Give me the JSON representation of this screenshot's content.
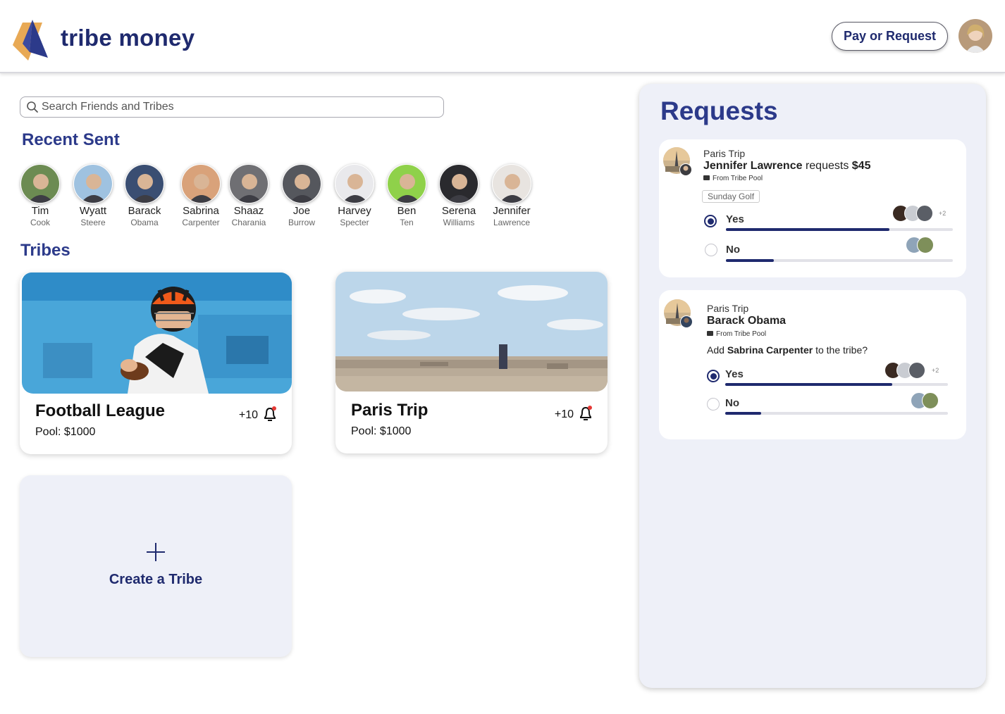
{
  "header": {
    "brand": "tribe money",
    "pay_request_label": "Pay or Request"
  },
  "search": {
    "placeholder": "Search Friends and Tribes",
    "value": ""
  },
  "recent": {
    "title": "Recent Sent",
    "friends": [
      {
        "first": "Tim",
        "last": "Cook",
        "color": "#6c8b52"
      },
      {
        "first": "Wyatt",
        "last": "Steere",
        "color": "#9fc2e0"
      },
      {
        "first": "Barack",
        "last": "Obama",
        "color": "#3a4e72"
      },
      {
        "first": "Sabrina",
        "last": "Carpenter",
        "color": "#d9a27a"
      },
      {
        "first": "Shaaz",
        "last": "Charania",
        "color": "#6f6f73"
      },
      {
        "first": "Joe",
        "last": "Burrow",
        "color": "#55575d"
      },
      {
        "first": "Harvey",
        "last": "Specter",
        "color": "#e9e9ec"
      },
      {
        "first": "Ben",
        "last": "Ten",
        "color": "#8fd14a"
      },
      {
        "first": "Serena",
        "last": "Williams",
        "color": "#2a2a2e"
      },
      {
        "first": "Jennifer",
        "last": "Lawrence",
        "color": "#e8e4e0"
      }
    ]
  },
  "tribes": {
    "title": "Tribes",
    "cards": [
      {
        "name": "Football League",
        "pool": "Pool: $1000",
        "count": "+10"
      },
      {
        "name": "Paris Trip",
        "pool": "Pool: $1000",
        "count": "+10"
      }
    ],
    "create_label": "Create a Tribe"
  },
  "requests": {
    "title": "Requests",
    "items": [
      {
        "tribe": "Paris Trip",
        "requester": "Jennifer Lawrence",
        "action": "requests",
        "amount": "$45",
        "from": "From Tribe Pool",
        "tag": "Sunday Golf",
        "yes_label": "Yes",
        "no_label": "No",
        "yes_extra": "+2",
        "yes_share": 0.72,
        "no_share": 0.21
      },
      {
        "tribe": "Paris Trip",
        "requester": "Barack Obama",
        "from": "From Tribe Pool",
        "question_prefix": "Add",
        "question_name": "Sabrina Carpenter",
        "question_suffix": "to the tribe?",
        "yes_label": "Yes",
        "no_label": "No",
        "yes_extra": "+2",
        "yes_share": 0.75,
        "no_share": 0.16
      }
    ]
  }
}
